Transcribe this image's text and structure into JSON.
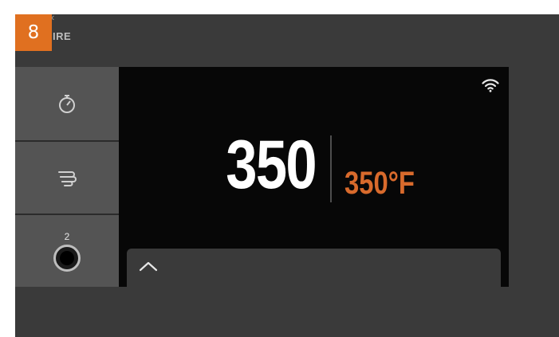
{
  "step": {
    "number": "8"
  },
  "header": {
    "label": "IRE"
  },
  "sidebar": {
    "timer": {
      "icon": "timer-icon"
    },
    "fan": {
      "icon": "fan-icon"
    },
    "probe": {
      "icon": "probe-icon",
      "count": "2"
    }
  },
  "display": {
    "current_temp": "350",
    "set_temp": "350°F",
    "wifi_icon": "wifi-icon",
    "drawer_icon": "chevron-up-icon"
  },
  "colors": {
    "accent": "#e07020",
    "set_temp": "#d86a2c",
    "screen_bg": "#070707",
    "panel_bg": "#3a3a3a",
    "button_bg": "#545454"
  }
}
